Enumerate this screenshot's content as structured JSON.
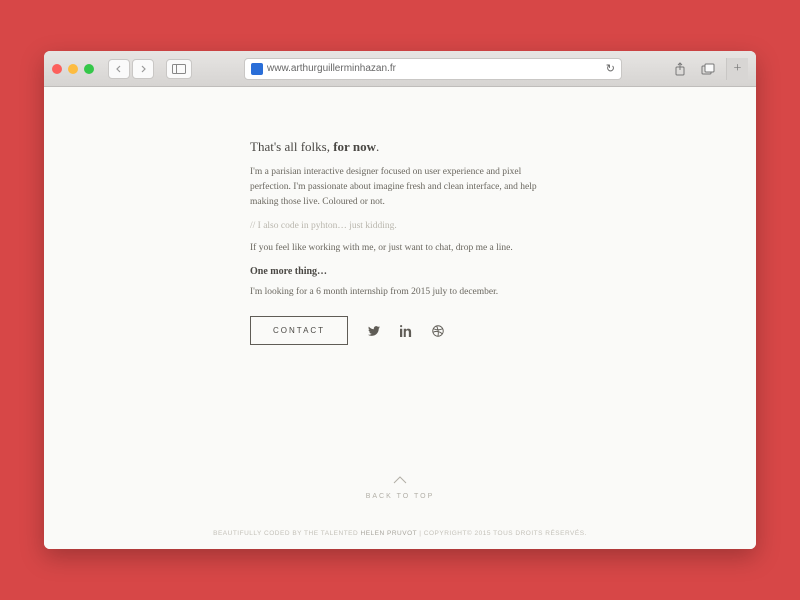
{
  "browser": {
    "url": "www.arthurguillerminhazan.fr"
  },
  "page": {
    "heading_pre": "That's all folks, ",
    "heading_bold": "for now",
    "heading_post": ".",
    "para1": "I'm a parisian interactive designer focused on user experience and pixel perfection. I'm passionate about imagine fresh and clean interface, and help making those live. Coloured or not.",
    "comment": "// I also code in pyhton… just kidding.",
    "para2": "If you feel like working with me, or just want to chat, drop me a line.",
    "subhead": "One more thing…",
    "para3": "I'm looking for a 6 month internship from 2015 july to december.",
    "contact_label": "CONTACT",
    "backtop_label": "BACK TO TOP"
  },
  "footer": {
    "prefix": "BEAUTIFULLY CODED BY THE TALENTED ",
    "name": "HELEN PRUVOT",
    "suffix": " | COPYRIGHT© 2015 TOUS DROITS RÉSERVÉS."
  }
}
